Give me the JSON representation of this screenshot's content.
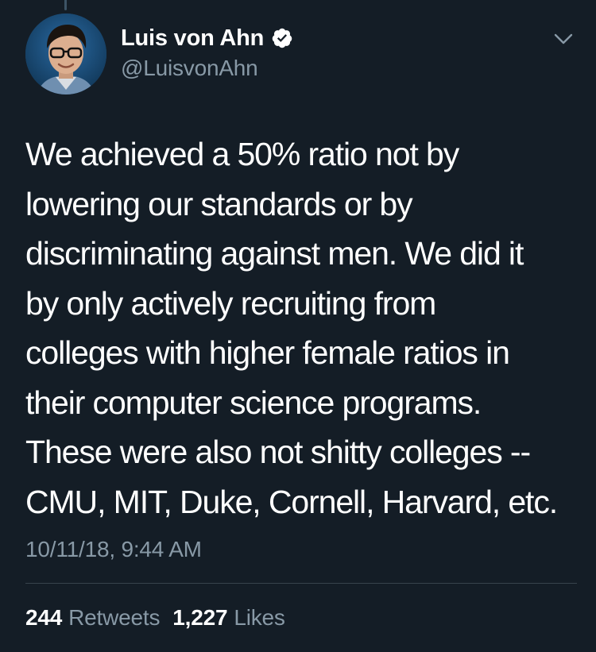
{
  "colors": {
    "background": "#141d26",
    "primary_text": "#ffffff",
    "secondary_text": "#8899a6",
    "divider": "#38444d",
    "verified_badge": "#ffffff"
  },
  "author": {
    "display_name": "Luis von Ahn",
    "handle": "@LuisvonAhn",
    "verified": true,
    "avatar_icon": "profile-photo"
  },
  "tweet": {
    "text": "We achieved a 50% ratio not by\nlowering our standards or by\ndiscriminating against men. We did it\nby only actively recruiting from\ncolleges with higher female ratios in\ntheir computer science programs.\nThese were also not shitty colleges --\nCMU, MIT, Duke, Cornell, Harvard, etc.",
    "timestamp": "10/11/18, 9:44 AM"
  },
  "stats": {
    "retweets_count": "244",
    "retweets_label": "Retweets",
    "likes_count": "1,227",
    "likes_label": "Likes"
  },
  "icons": {
    "menu": "chevron-down-icon",
    "badge": "verified-badge-icon"
  }
}
